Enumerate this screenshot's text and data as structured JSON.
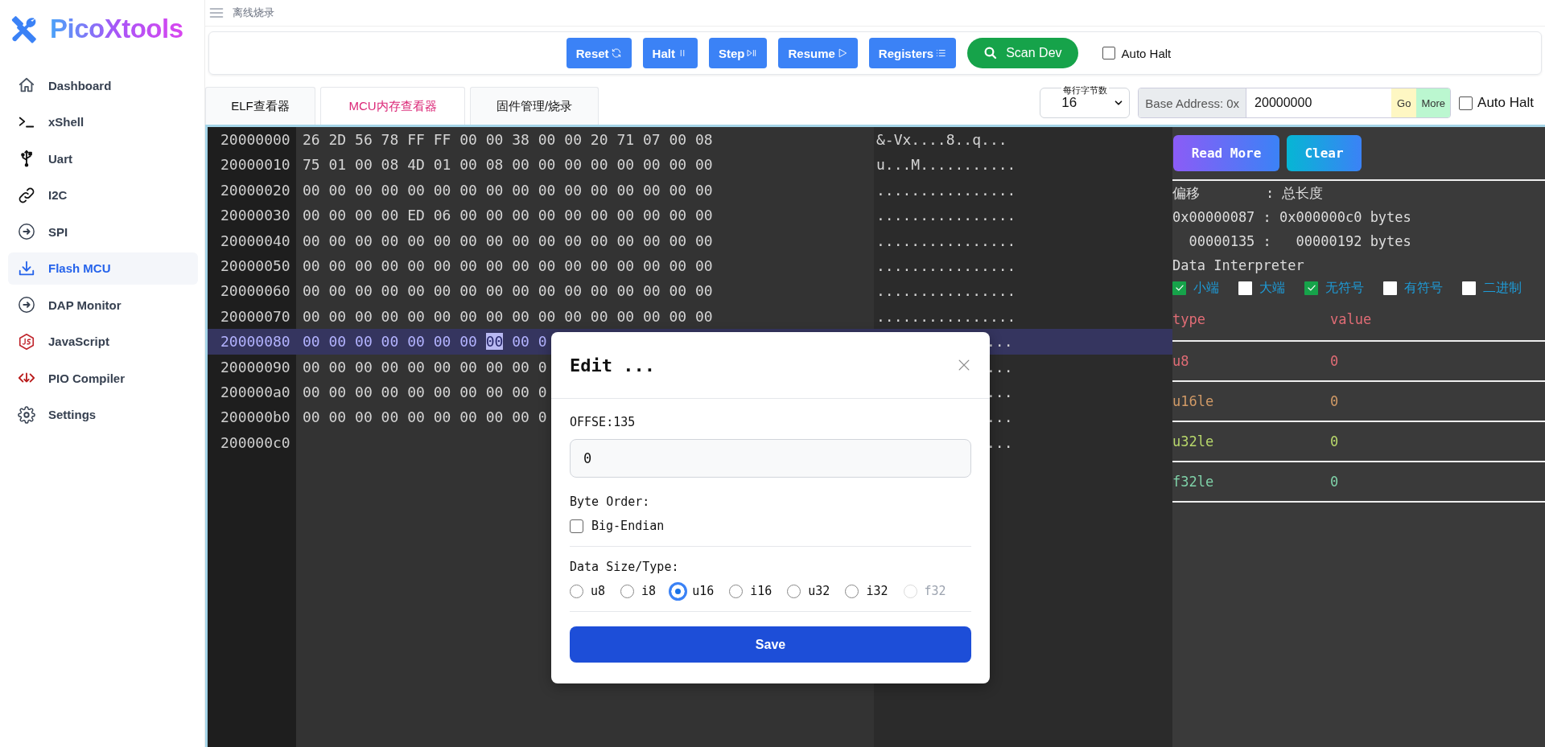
{
  "sidebar": {
    "logo": "PicoXtools",
    "items": [
      {
        "label": "Dashboard",
        "selected": false
      },
      {
        "label": "xShell",
        "selected": false
      },
      {
        "label": "Uart",
        "selected": false
      },
      {
        "label": "I2C",
        "selected": false
      },
      {
        "label": "SPI",
        "selected": false
      },
      {
        "label": "Flash MCU",
        "selected": true
      },
      {
        "label": "DAP Monitor",
        "selected": false
      },
      {
        "label": "JavaScript",
        "selected": false
      },
      {
        "label": "PIO Compiler",
        "selected": false
      },
      {
        "label": "Settings",
        "selected": false
      }
    ]
  },
  "header": {
    "breadcrumb": "离线烧录"
  },
  "toolbar": {
    "buttons": [
      {
        "label": "Reset",
        "kind": "debug"
      },
      {
        "label": "Halt",
        "kind": "debug"
      },
      {
        "label": "Step",
        "kind": "debug"
      },
      {
        "label": "Resume",
        "kind": "debug"
      },
      {
        "label": "Registers",
        "kind": "debug"
      },
      {
        "label": "Scan Dev",
        "kind": "scan"
      }
    ],
    "auto_halt": {
      "label": "Auto Halt",
      "checked": false
    }
  },
  "tabs": [
    {
      "label": "ELF查看器",
      "selected": false
    },
    {
      "label": "MCU内存查看器",
      "selected": true
    },
    {
      "label": "固件管理/烧录",
      "selected": false
    }
  ],
  "bytes_per_row": {
    "label": "每行字节数",
    "value": "16"
  },
  "base_address": {
    "prefix": "Base Address: 0x",
    "value": "20000000",
    "go": "Go",
    "more": "More"
  },
  "auto_halt_2": {
    "label": "Auto Halt",
    "checked": false
  },
  "hex": {
    "rows": [
      {
        "address": "20000000",
        "kind": "full",
        "selected": false,
        "ascii": "&-Vx....8..q...",
        "bytes": [
          {
            "value": "26",
            "selected": false
          },
          {
            "value": "2D",
            "selected": false
          },
          {
            "value": "56",
            "selected": false
          },
          {
            "value": "78",
            "selected": false
          },
          {
            "value": "FF",
            "selected": false
          },
          {
            "value": "FF",
            "selected": false
          },
          {
            "value": "00",
            "selected": false
          },
          {
            "value": "00",
            "selected": false
          },
          {
            "value": "38",
            "selected": false
          },
          {
            "value": "00",
            "selected": false
          },
          {
            "value": "00",
            "selected": false
          },
          {
            "value": "20",
            "selected": false
          },
          {
            "value": "71",
            "selected": false
          },
          {
            "value": "07",
            "selected": false
          },
          {
            "value": "00",
            "selected": false
          },
          {
            "value": "08",
            "selected": false
          }
        ]
      },
      {
        "address": "20000010",
        "kind": "full",
        "selected": false,
        "ascii": "u...M...........",
        "bytes": [
          {
            "value": "75",
            "selected": false
          },
          {
            "value": "01",
            "selected": false
          },
          {
            "value": "00",
            "selected": false
          },
          {
            "value": "08",
            "selected": false
          },
          {
            "value": "4D",
            "selected": false
          },
          {
            "value": "01",
            "selected": false
          },
          {
            "value": "00",
            "selected": false
          },
          {
            "value": "08",
            "selected": false
          },
          {
            "value": "00",
            "selected": false
          },
          {
            "value": "00",
            "selected": false
          },
          {
            "value": "00",
            "selected": false
          },
          {
            "value": "00",
            "selected": false
          },
          {
            "value": "00",
            "selected": false
          },
          {
            "value": "00",
            "selected": false
          },
          {
            "value": "00",
            "selected": false
          },
          {
            "value": "00",
            "selected": false
          }
        ]
      },
      {
        "address": "20000020",
        "kind": "full",
        "selected": false,
        "ascii": "................",
        "bytes": [
          {
            "value": "00",
            "selected": false
          },
          {
            "value": "00",
            "selected": false
          },
          {
            "value": "00",
            "selected": false
          },
          {
            "value": "00",
            "selected": false
          },
          {
            "value": "00",
            "selected": false
          },
          {
            "value": "00",
            "selected": false
          },
          {
            "value": "00",
            "selected": false
          },
          {
            "value": "00",
            "selected": false
          },
          {
            "value": "00",
            "selected": false
          },
          {
            "value": "00",
            "selected": false
          },
          {
            "value": "00",
            "selected": false
          },
          {
            "value": "00",
            "selected": false
          },
          {
            "value": "00",
            "selected": false
          },
          {
            "value": "00",
            "selected": false
          },
          {
            "value": "00",
            "selected": false
          },
          {
            "value": "00",
            "selected": false
          }
        ]
      },
      {
        "address": "20000030",
        "kind": "full",
        "selected": false,
        "ascii": "................",
        "bytes": [
          {
            "value": "00",
            "selected": false
          },
          {
            "value": "00",
            "selected": false
          },
          {
            "value": "00",
            "selected": false
          },
          {
            "value": "00",
            "selected": false
          },
          {
            "value": "ED",
            "selected": false
          },
          {
            "value": "06",
            "selected": false
          },
          {
            "value": "00",
            "selected": false
          },
          {
            "value": "00",
            "selected": false
          },
          {
            "value": "00",
            "selected": false
          },
          {
            "value": "00",
            "selected": false
          },
          {
            "value": "00",
            "selected": false
          },
          {
            "value": "00",
            "selected": false
          },
          {
            "value": "00",
            "selected": false
          },
          {
            "value": "00",
            "selected": false
          },
          {
            "value": "00",
            "selected": false
          },
          {
            "value": "00",
            "selected": false
          }
        ]
      },
      {
        "address": "20000040",
        "kind": "full",
        "selected": false,
        "ascii": "................",
        "bytes": [
          {
            "value": "00",
            "selected": false
          },
          {
            "value": "00",
            "selected": false
          },
          {
            "value": "00",
            "selected": false
          },
          {
            "value": "00",
            "selected": false
          },
          {
            "value": "00",
            "selected": false
          },
          {
            "value": "00",
            "selected": false
          },
          {
            "value": "00",
            "selected": false
          },
          {
            "value": "00",
            "selected": false
          },
          {
            "value": "00",
            "selected": false
          },
          {
            "value": "00",
            "selected": false
          },
          {
            "value": "00",
            "selected": false
          },
          {
            "value": "00",
            "selected": false
          },
          {
            "value": "00",
            "selected": false
          },
          {
            "value": "00",
            "selected": false
          },
          {
            "value": "00",
            "selected": false
          },
          {
            "value": "00",
            "selected": false
          }
        ]
      },
      {
        "address": "20000050",
        "kind": "full",
        "selected": false,
        "ascii": "................",
        "bytes": [
          {
            "value": "00",
            "selected": false
          },
          {
            "value": "00",
            "selected": false
          },
          {
            "value": "00",
            "selected": false
          },
          {
            "value": "00",
            "selected": false
          },
          {
            "value": "00",
            "selected": false
          },
          {
            "value": "00",
            "selected": false
          },
          {
            "value": "00",
            "selected": false
          },
          {
            "value": "00",
            "selected": false
          },
          {
            "value": "00",
            "selected": false
          },
          {
            "value": "00",
            "selected": false
          },
          {
            "value": "00",
            "selected": false
          },
          {
            "value": "00",
            "selected": false
          },
          {
            "value": "00",
            "selected": false
          },
          {
            "value": "00",
            "selected": false
          },
          {
            "value": "00",
            "selected": false
          },
          {
            "value": "00",
            "selected": false
          }
        ]
      },
      {
        "address": "20000060",
        "kind": "full",
        "selected": false,
        "ascii": "................",
        "bytes": [
          {
            "value": "00",
            "selected": false
          },
          {
            "value": "00",
            "selected": false
          },
          {
            "value": "00",
            "selected": false
          },
          {
            "value": "00",
            "selected": false
          },
          {
            "value": "00",
            "selected": false
          },
          {
            "value": "00",
            "selected": false
          },
          {
            "value": "00",
            "selected": false
          },
          {
            "value": "00",
            "selected": false
          },
          {
            "value": "00",
            "selected": false
          },
          {
            "value": "00",
            "selected": false
          },
          {
            "value": "00",
            "selected": false
          },
          {
            "value": "00",
            "selected": false
          },
          {
            "value": "00",
            "selected": false
          },
          {
            "value": "00",
            "selected": false
          },
          {
            "value": "00",
            "selected": false
          },
          {
            "value": "00",
            "selected": false
          }
        ]
      },
      {
        "address": "20000070",
        "kind": "full",
        "selected": false,
        "ascii": "................",
        "bytes": [
          {
            "value": "00",
            "selected": false
          },
          {
            "value": "00",
            "selected": false
          },
          {
            "value": "00",
            "selected": false
          },
          {
            "value": "00",
            "selected": false
          },
          {
            "value": "00",
            "selected": false
          },
          {
            "value": "00",
            "selected": false
          },
          {
            "value": "00",
            "selected": false
          },
          {
            "value": "00",
            "selected": false
          },
          {
            "value": "00",
            "selected": false
          },
          {
            "value": "00",
            "selected": false
          },
          {
            "value": "00",
            "selected": false
          },
          {
            "value": "00",
            "selected": false
          },
          {
            "value": "00",
            "selected": false
          },
          {
            "value": "00",
            "selected": false
          },
          {
            "value": "00",
            "selected": false
          },
          {
            "value": "00",
            "selected": false
          }
        ]
      },
      {
        "address": "20000080",
        "kind": "covered",
        "selected": true,
        "ascii": "...",
        "bytes": [
          {
            "value": "00",
            "selected": false
          },
          {
            "value": "00",
            "selected": false
          },
          {
            "value": "00",
            "selected": false
          },
          {
            "value": "00",
            "selected": false
          },
          {
            "value": "00",
            "selected": false
          },
          {
            "value": "00",
            "selected": false
          },
          {
            "value": "00",
            "selected": false
          },
          {
            "value": "00",
            "selected": true
          },
          {
            "value": "00",
            "selected": false
          },
          {
            "value": "0",
            "selected": false
          }
        ]
      },
      {
        "address": "20000090",
        "kind": "covered",
        "selected": false,
        "ascii": "...",
        "bytes": [
          {
            "value": "00",
            "selected": false
          },
          {
            "value": "00",
            "selected": false
          },
          {
            "value": "00",
            "selected": false
          },
          {
            "value": "00",
            "selected": false
          },
          {
            "value": "00",
            "selected": false
          },
          {
            "value": "00",
            "selected": false
          },
          {
            "value": "00",
            "selected": false
          },
          {
            "value": "00",
            "selected": false
          },
          {
            "value": "00",
            "selected": false
          },
          {
            "value": "0",
            "selected": false
          }
        ]
      },
      {
        "address": "200000a0",
        "kind": "covered",
        "selected": false,
        "ascii": "...",
        "bytes": [
          {
            "value": "00",
            "selected": false
          },
          {
            "value": "00",
            "selected": false
          },
          {
            "value": "00",
            "selected": false
          },
          {
            "value": "00",
            "selected": false
          },
          {
            "value": "00",
            "selected": false
          },
          {
            "value": "00",
            "selected": false
          },
          {
            "value": "00",
            "selected": false
          },
          {
            "value": "00",
            "selected": false
          },
          {
            "value": "00",
            "selected": false
          },
          {
            "value": "0",
            "selected": false
          }
        ]
      },
      {
        "address": "200000b0",
        "kind": "covered",
        "selected": false,
        "ascii": "...",
        "bytes": [
          {
            "value": "00",
            "selected": false
          },
          {
            "value": "00",
            "selected": false
          },
          {
            "value": "00",
            "selected": false
          },
          {
            "value": "00",
            "selected": false
          },
          {
            "value": "00",
            "selected": false
          },
          {
            "value": "00",
            "selected": false
          },
          {
            "value": "00",
            "selected": false
          },
          {
            "value": "00",
            "selected": false
          },
          {
            "value": "00",
            "selected": false
          },
          {
            "value": "0",
            "selected": false
          }
        ]
      },
      {
        "address": "200000c0",
        "kind": "covered",
        "selected": false,
        "ascii": "..."
      }
    ]
  },
  "interpreter": {
    "buttons": [
      {
        "label": "Read More",
        "kind": "gradient"
      },
      {
        "label": "Clear",
        "kind": "cyan"
      }
    ],
    "lines": [
      "偏移        : 总长度",
      "0x00000087 : 0x000000c0 bytes",
      "  00000135 :   00000192 bytes"
    ],
    "title": "Data Interpreter",
    "options": [
      {
        "label": "小端",
        "checked": true
      },
      {
        "label": "大端",
        "checked": false
      },
      {
        "label": "无符号",
        "checked": true
      },
      {
        "label": "有符号",
        "checked": false
      },
      {
        "label": "二进制",
        "checked": false
      }
    ],
    "columns": [
      "type",
      "value"
    ],
    "rows": [
      {
        "type": "u8",
        "value": "0",
        "color": "#e06c75"
      },
      {
        "type": "u16le",
        "value": "0",
        "color": "#d19a66"
      },
      {
        "type": "u32le",
        "value": "0",
        "color": "#b8d86b"
      },
      {
        "type": "f32le",
        "value": "0",
        "color": "#7fd1a8"
      }
    ]
  },
  "dialog": {
    "title": "Edit ...",
    "offset_label": "OFFSE:135",
    "value": "0",
    "byte_order_label": "Byte Order:",
    "big_endian": {
      "label": "Big-Endian",
      "checked": false
    },
    "type_label": "Data Size/Type:",
    "types": [
      {
        "label": "u8",
        "selected": false,
        "disabled": false
      },
      {
        "label": "i8",
        "selected": false,
        "disabled": false
      },
      {
        "label": "u16",
        "selected": true,
        "disabled": false
      },
      {
        "label": "i16",
        "selected": false,
        "disabled": false
      },
      {
        "label": "u32",
        "selected": false,
        "disabled": false
      },
      {
        "label": "i32",
        "selected": false,
        "disabled": false
      },
      {
        "label": "f32",
        "selected": false,
        "disabled": true
      }
    ],
    "save": "Save"
  }
}
